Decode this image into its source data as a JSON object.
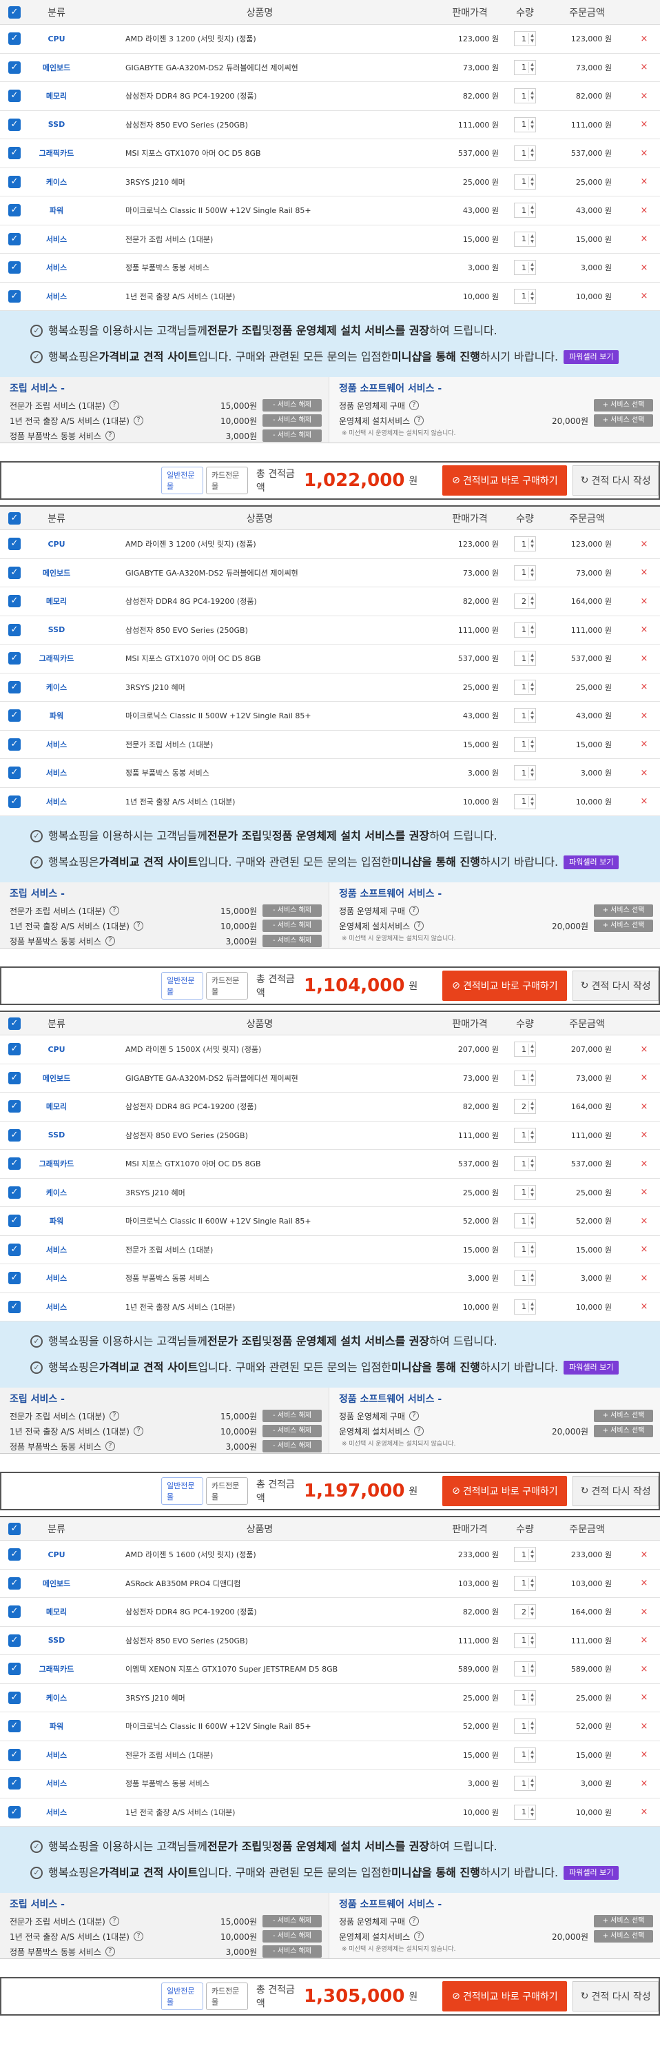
{
  "headers": {
    "category": "분류",
    "product": "상품명",
    "price": "판매가격",
    "qty": "수량",
    "amount": "주문금액"
  },
  "check_mark": "✓",
  "delete_mark": "×",
  "notice": {
    "line1": [
      "행복쇼핑을 이용하시는 고객님들께 ",
      "전문가 조립",
      " 및 ",
      "정품 운영체제 설치 서비스를 권장",
      "하여 드립니다."
    ],
    "line2": [
      "행복쇼핑은 ",
      "가격비교 견적 사이트",
      "입니다. 구매와 관련된 모든 문의는 입점한 ",
      "미니샵을 통해 진행",
      "하시기 바랍니다."
    ],
    "pill": "파워셀러 보기"
  },
  "assembly": {
    "title": "조립 서비스 -",
    "items": [
      {
        "name": "전문가 조립 서비스 (1대분)",
        "price": "15,000원",
        "button": "- 서비스 해제"
      },
      {
        "name": "1년 전국 출장 A/S 서비스 (1대분)",
        "price": "10,000원",
        "button": "- 서비스 해제"
      },
      {
        "name": "정품 부품박스 동봉 서비스",
        "price": "3,000원",
        "button": "- 서비스 해제"
      }
    ]
  },
  "software": {
    "title": "정품 소프트웨어 서비스 -",
    "items": [
      {
        "name": "정품 운영체제 구매",
        "price": "",
        "button": "+ 서비스 선택"
      },
      {
        "name": "운영체제 설치서비스",
        "price": "20,000원",
        "button": "+ 서비스 선택"
      }
    ],
    "note": "※ 미선택 시 운영체제는 설치되지 않습니다."
  },
  "totalbar": {
    "tag1": "일반전문몰",
    "tag2": "카드전문몰",
    "label": "총 견적금액",
    "won": "원",
    "buy": "견적비교 바로 구매하기",
    "redo": "견적 다시 작성"
  },
  "quotes": [
    {
      "total": "1,022,000",
      "items": [
        {
          "cat": "CPU",
          "name": "AMD 라이젠 3 1200 (서밋 릿지) (정품)",
          "price": "123,000 원",
          "qty": "1",
          "amount": "123,000 원"
        },
        {
          "cat": "메인보드",
          "name": "GIGABYTE GA-A320M-DS2 듀러블에디션 제이씨현",
          "price": "73,000 원",
          "qty": "1",
          "amount": "73,000 원"
        },
        {
          "cat": "메모리",
          "name": "삼성전자 DDR4 8G PC4-19200 (정품)",
          "price": "82,000 원",
          "qty": "1",
          "amount": "82,000 원"
        },
        {
          "cat": "SSD",
          "name": "삼성전자 850 EVO Series (250GB)",
          "price": "111,000 원",
          "qty": "1",
          "amount": "111,000 원"
        },
        {
          "cat": "그래픽카드",
          "name": "MSI 지포스 GTX1070 아머 OC D5 8GB",
          "price": "537,000 원",
          "qty": "1",
          "amount": "537,000 원"
        },
        {
          "cat": "케이스",
          "name": "3RSYS J210 혜머",
          "price": "25,000 원",
          "qty": "1",
          "amount": "25,000 원"
        },
        {
          "cat": "파워",
          "name": "마이크로닉스 Classic II 500W +12V Single Rail 85+",
          "price": "43,000 원",
          "qty": "1",
          "amount": "43,000 원"
        },
        {
          "cat": "서비스",
          "name": "전문가 조립 서비스 (1대분)",
          "price": "15,000 원",
          "qty": "1",
          "amount": "15,000 원"
        },
        {
          "cat": "서비스",
          "name": "정품 부품박스 동봉 서비스",
          "price": "3,000 원",
          "qty": "1",
          "amount": "3,000 원"
        },
        {
          "cat": "서비스",
          "name": "1년 전국 출장 A/S 서비스 (1대분)",
          "price": "10,000 원",
          "qty": "1",
          "amount": "10,000 원"
        }
      ]
    },
    {
      "total": "1,104,000",
      "items": [
        {
          "cat": "CPU",
          "name": "AMD 라이젠 3 1200 (서밋 릿지) (정품)",
          "price": "123,000 원",
          "qty": "1",
          "amount": "123,000 원"
        },
        {
          "cat": "메인보드",
          "name": "GIGABYTE GA-A320M-DS2 듀러블에디션 제이씨현",
          "price": "73,000 원",
          "qty": "1",
          "amount": "73,000 원"
        },
        {
          "cat": "메모리",
          "name": "삼성전자 DDR4 8G PC4-19200 (정품)",
          "price": "82,000 원",
          "qty": "2",
          "amount": "164,000 원"
        },
        {
          "cat": "SSD",
          "name": "삼성전자 850 EVO Series (250GB)",
          "price": "111,000 원",
          "qty": "1",
          "amount": "111,000 원"
        },
        {
          "cat": "그래픽카드",
          "name": "MSI 지포스 GTX1070 아머 OC D5 8GB",
          "price": "537,000 원",
          "qty": "1",
          "amount": "537,000 원"
        },
        {
          "cat": "케이스",
          "name": "3RSYS J210 혜머",
          "price": "25,000 원",
          "qty": "1",
          "amount": "25,000 원"
        },
        {
          "cat": "파워",
          "name": "마이크로닉스 Classic II 500W +12V Single Rail 85+",
          "price": "43,000 원",
          "qty": "1",
          "amount": "43,000 원"
        },
        {
          "cat": "서비스",
          "name": "전문가 조립 서비스 (1대분)",
          "price": "15,000 원",
          "qty": "1",
          "amount": "15,000 원"
        },
        {
          "cat": "서비스",
          "name": "정품 부품박스 동봉 서비스",
          "price": "3,000 원",
          "qty": "1",
          "amount": "3,000 원"
        },
        {
          "cat": "서비스",
          "name": "1년 전국 출장 A/S 서비스 (1대분)",
          "price": "10,000 원",
          "qty": "1",
          "amount": "10,000 원"
        }
      ]
    },
    {
      "total": "1,197,000",
      "items": [
        {
          "cat": "CPU",
          "name": "AMD 라이젠 5 1500X (서밋 릿지) (정품)",
          "price": "207,000 원",
          "qty": "1",
          "amount": "207,000 원"
        },
        {
          "cat": "메인보드",
          "name": "GIGABYTE GA-A320M-DS2 듀러블에디션 제이씨현",
          "price": "73,000 원",
          "qty": "1",
          "amount": "73,000 원"
        },
        {
          "cat": "메모리",
          "name": "삼성전자 DDR4 8G PC4-19200 (정품)",
          "price": "82,000 원",
          "qty": "2",
          "amount": "164,000 원"
        },
        {
          "cat": "SSD",
          "name": "삼성전자 850 EVO Series (250GB)",
          "price": "111,000 원",
          "qty": "1",
          "amount": "111,000 원"
        },
        {
          "cat": "그래픽카드",
          "name": "MSI 지포스 GTX1070 아머 OC D5 8GB",
          "price": "537,000 원",
          "qty": "1",
          "amount": "537,000 원"
        },
        {
          "cat": "케이스",
          "name": "3RSYS J210 혜머",
          "price": "25,000 원",
          "qty": "1",
          "amount": "25,000 원"
        },
        {
          "cat": "파워",
          "name": "마이크로닉스 Classic II 600W +12V Single Rail 85+",
          "price": "52,000 원",
          "qty": "1",
          "amount": "52,000 원"
        },
        {
          "cat": "서비스",
          "name": "전문가 조립 서비스 (1대분)",
          "price": "15,000 원",
          "qty": "1",
          "amount": "15,000 원"
        },
        {
          "cat": "서비스",
          "name": "정품 부품박스 동봉 서비스",
          "price": "3,000 원",
          "qty": "1",
          "amount": "3,000 원"
        },
        {
          "cat": "서비스",
          "name": "1년 전국 출장 A/S 서비스 (1대분)",
          "price": "10,000 원",
          "qty": "1",
          "amount": "10,000 원"
        }
      ]
    },
    {
      "total": "1,305,000",
      "items": [
        {
          "cat": "CPU",
          "name": "AMD 라이젠 5 1600 (서밋 릿지) (정품)",
          "price": "233,000 원",
          "qty": "1",
          "amount": "233,000 원"
        },
        {
          "cat": "메인보드",
          "name": "ASRock AB350M PRO4 디앤디컴",
          "price": "103,000 원",
          "qty": "1",
          "amount": "103,000 원"
        },
        {
          "cat": "메모리",
          "name": "삼성전자 DDR4 8G PC4-19200 (정품)",
          "price": "82,000 원",
          "qty": "2",
          "amount": "164,000 원"
        },
        {
          "cat": "SSD",
          "name": "삼성전자 850 EVO Series (250GB)",
          "price": "111,000 원",
          "qty": "1",
          "amount": "111,000 원"
        },
        {
          "cat": "그래픽카드",
          "name": "이엠텍 XENON 지포스 GTX1070 Super JETSTREAM D5 8GB",
          "price": "589,000 원",
          "qty": "1",
          "amount": "589,000 원"
        },
        {
          "cat": "케이스",
          "name": "3RSYS J210 혜머",
          "price": "25,000 원",
          "qty": "1",
          "amount": "25,000 원"
        },
        {
          "cat": "파워",
          "name": "마이크로닉스 Classic II 600W +12V Single Rail 85+",
          "price": "52,000 원",
          "qty": "1",
          "amount": "52,000 원"
        },
        {
          "cat": "서비스",
          "name": "전문가 조립 서비스 (1대분)",
          "price": "15,000 원",
          "qty": "1",
          "amount": "15,000 원"
        },
        {
          "cat": "서비스",
          "name": "정품 부품박스 동봉 서비스",
          "price": "3,000 원",
          "qty": "1",
          "amount": "3,000 원"
        },
        {
          "cat": "서비스",
          "name": "1년 전국 출장 A/S 서비스 (1대분)",
          "price": "10,000 원",
          "qty": "1",
          "amount": "10,000 원"
        }
      ]
    }
  ]
}
